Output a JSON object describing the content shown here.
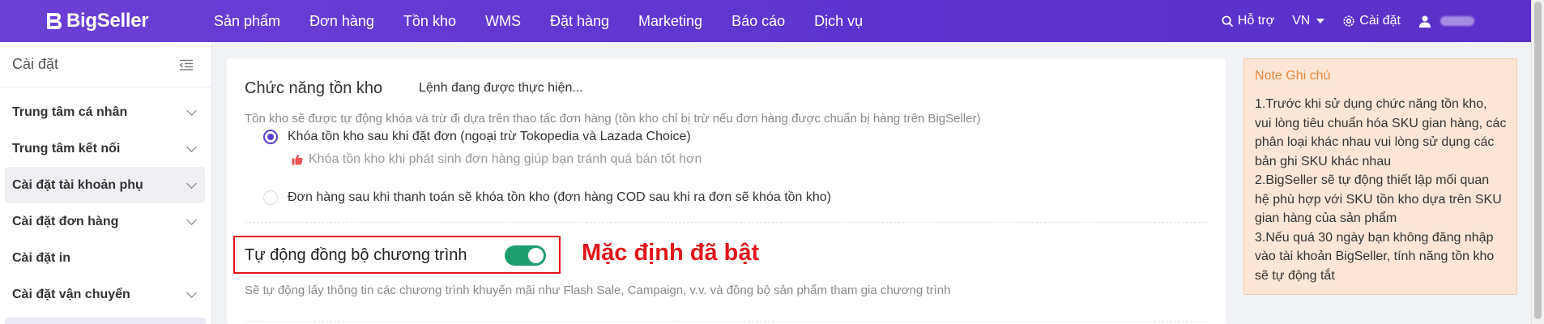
{
  "brand": {
    "name": "BigSeller",
    "accent": "#5a3fd0",
    "annotation_color": "#e0161c",
    "toggle_color": "#1f9d6e"
  },
  "topnav": {
    "items": [
      "Sản phẩm",
      "Đơn hàng",
      "Tồn kho",
      "WMS",
      "Đặt hàng",
      "Marketing",
      "Báo cáo",
      "Dịch vụ"
    ],
    "help": "Hỗ trợ",
    "language": "VN",
    "settings": "Cài đặt"
  },
  "sidebar": {
    "title": "Cài đặt",
    "items": [
      {
        "label": "Trung tâm cá nhân",
        "expandable": true
      },
      {
        "label": "Trung tâm kết nối",
        "expandable": true
      },
      {
        "label": "Cài đặt tài khoản phụ",
        "expandable": true,
        "active": true
      },
      {
        "label": "Cài đặt đơn hàng",
        "expandable": true
      },
      {
        "label": "Cài đặt in",
        "expandable": false
      },
      {
        "label": "Cài đặt vận chuyển",
        "expandable": true
      }
    ]
  },
  "inventory": {
    "title": "Chức năng tồn kho",
    "status": "Lệnh đang được thực hiện...",
    "description": "Tồn kho sẽ được tự động khóa và trừ đi dựa trên thao tác đơn hàng (tồn kho chỉ bị trừ nếu đơn hàng được chuẩn bị hàng trên BigSeller)",
    "option1": "Khóa tồn kho sau khi đặt đơn (ngoại trừ Tokopedia và Lazada Choice)",
    "option1_tip": "Khóa tồn kho khi phát sinh đơn hàng giúp bạn tránh quá bán tốt hơn",
    "option2": "Đơn hàng sau khi thanh toán sẽ khóa tồn kho (đơn hàng COD sau khi ra đơn sẽ khóa tồn kho)",
    "selected_option": 1
  },
  "sync": {
    "label": "Tự động đồng bộ chương trình",
    "enabled": true,
    "annotation": "Mặc định đã bật",
    "description": "Sẽ tự động lấy thông tin các chương trình khuyến mãi như Flash Sale, Campaign, v.v. và đồng bộ sản phẩm tham gia chương trình"
  },
  "note": {
    "title": "Note Ghi chú",
    "lines": [
      "1.Trước khi sử dụng chức năng tồn kho, vui lòng tiêu chuẩn hóa SKU gian hàng, các phân loại khác nhau vui lòng sử dụng các bản ghi SKU khác nhau",
      "2.BigSeller sẽ tự động thiết lập mối quan hệ phù hợp với SKU tồn kho dựa trên SKU gian hàng của sản phẩm",
      "3.Nếu quá 30 ngày bạn không đăng nhập vào tài khoản BigSeller, tính năng tồn kho sẽ tự động tắt"
    ]
  }
}
